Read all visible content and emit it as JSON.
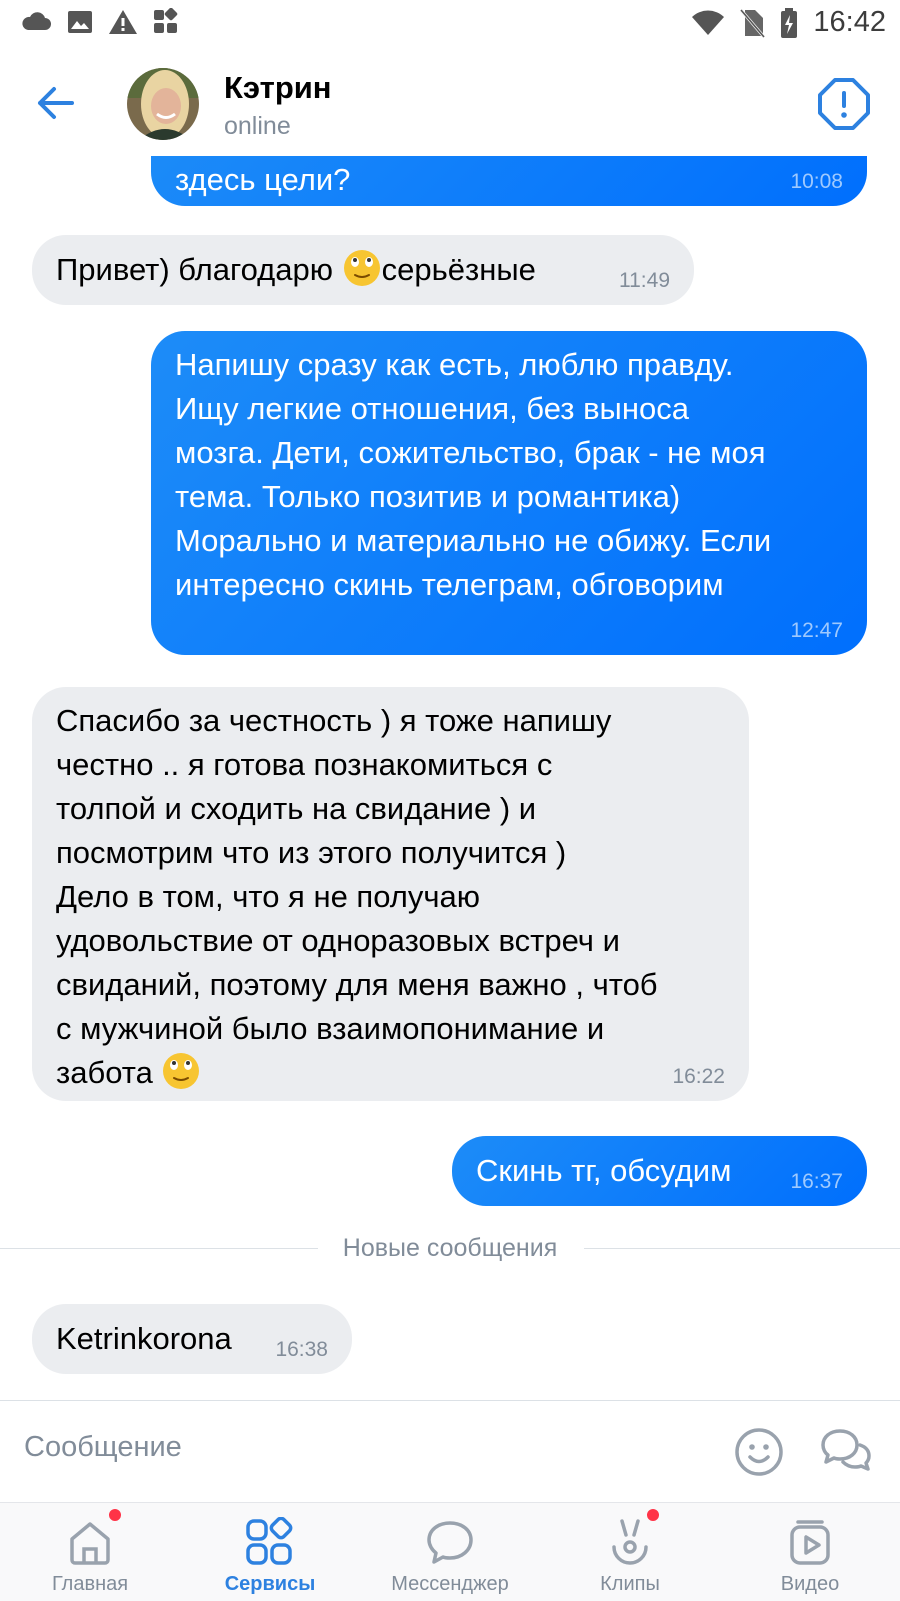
{
  "status_bar": {
    "time": "16:42",
    "left_icons": [
      "cloud-icon",
      "image-icon",
      "warning-icon",
      "apps-icon"
    ],
    "right_icons": [
      "wifi-icon",
      "no-sim-icon",
      "battery-charging-icon"
    ]
  },
  "header": {
    "contact_name": "Кэтрин",
    "contact_status": "online",
    "back_icon": "arrow-left-icon",
    "report_icon": "report-icon"
  },
  "messages": [
    {
      "direction": "out",
      "text": "здесь цели?",
      "time": "10:08"
    },
    {
      "direction": "in",
      "text_before": "Привет) благодарю ",
      "emoji": "relieved-face-icon",
      "text_after": "серьёзные",
      "time": "11:49"
    },
    {
      "direction": "out",
      "text": "Напишу сразу как есть, люблю правду.\nИщу легкие отношения, без выноса\nмозга. Дети, сожительство, брак - не моя\nтема. Только позитив и романтика)\nМорально и материально не обижу. Если\nинтересно скинь телеграм, обговорим",
      "time": "12:47"
    },
    {
      "direction": "in",
      "text": "Спасибо за честность ) я тоже напишу\nчестно .. я готова познакомиться с\nтолпой и сходить на свидание ) и\nпосмотрим что из этого получится )\nДело в том, что я не получаю\nудовольствие от одноразовых встреч и\nсвиданий, поэтому для меня важно , чтоб\nс мужчиной было взаимопонимание и\nзабота ",
      "emoji": "relieved-face-icon",
      "time": "16:22"
    },
    {
      "direction": "out",
      "text": "Скинь тг, обсудим",
      "time": "16:37"
    },
    {
      "direction": "in",
      "text": "Ketrinkorona",
      "time": "16:38"
    }
  ],
  "new_messages_divider": "Новые сообщения",
  "composer": {
    "placeholder": "Сообщение",
    "emoji_icon": "smile-icon",
    "voice_icon": "chat-bubbles-icon"
  },
  "tabs": [
    {
      "label": "Главная",
      "icon": "home-icon",
      "badge": true,
      "active": false
    },
    {
      "label": "Сервисы",
      "icon": "services-grid-icon",
      "badge": false,
      "active": true
    },
    {
      "label": "Мессенджер",
      "icon": "messenger-icon",
      "badge": false,
      "active": false
    },
    {
      "label": "Клипы",
      "icon": "clips-icon",
      "badge": true,
      "active": false
    },
    {
      "label": "Видео",
      "icon": "video-icon",
      "badge": false,
      "active": false
    }
  ],
  "colors": {
    "accent": "#2d81e0",
    "outgoing_bubble": "#0a7cfd",
    "incoming_bubble": "#ebedf0",
    "badge": "#ff3347",
    "secondary_text": "#818c99"
  }
}
